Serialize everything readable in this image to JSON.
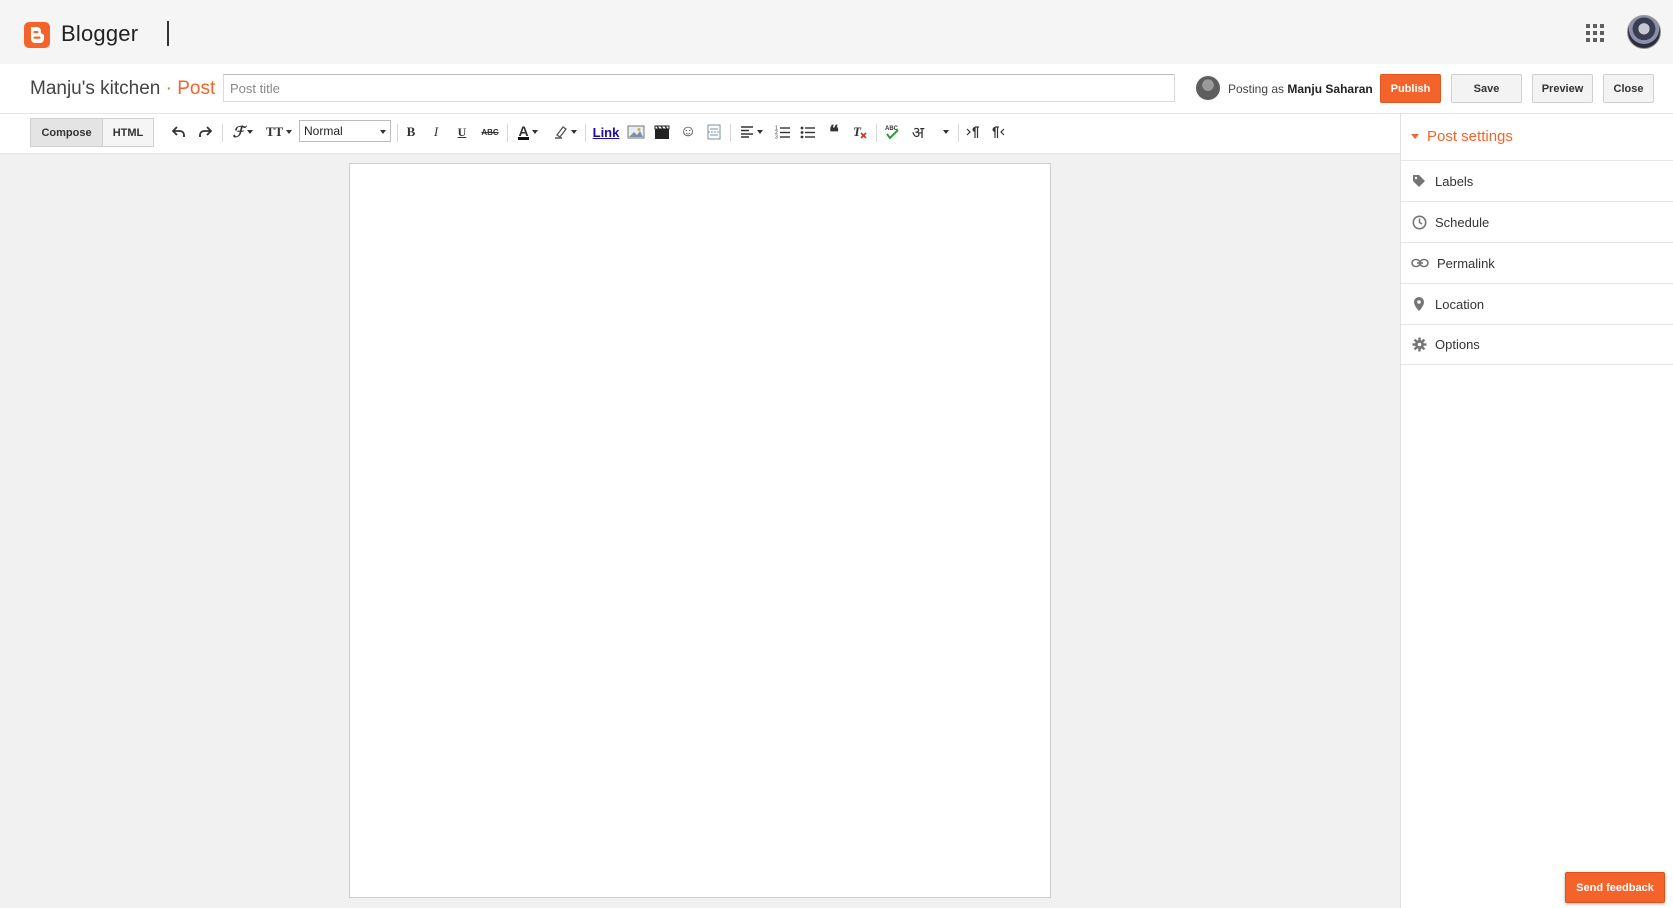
{
  "app": {
    "brand": "Blogger",
    "accent_color": "#f4642a",
    "logo_icon": "blogger-b-icon",
    "apps_icon": "apps-grid-icon"
  },
  "header": {
    "blog_name": "Manju's kitchen",
    "separator": "·",
    "kind": "Post",
    "title_placeholder": "Post title",
    "title_value": "",
    "posting_as_prefix": "Posting as",
    "posting_as_name": "Manju Saharan",
    "buttons": {
      "publish": "Publish",
      "save": "Save",
      "preview": "Preview",
      "close": "Close"
    }
  },
  "toolbar": {
    "modes": {
      "compose": "Compose",
      "html": "HTML",
      "active": "compose"
    },
    "paragraph_format": "Normal",
    "link_label": "Link",
    "icons": [
      "undo-icon",
      "redo-icon",
      "font-family-icon",
      "font-size-icon",
      "bold-icon",
      "italic-icon",
      "underline-icon",
      "strikethrough-icon",
      "text-color-icon",
      "highlight-color-icon",
      "link-icon",
      "insert-image-icon",
      "insert-video-icon",
      "emoji-icon",
      "jump-break-icon",
      "align-icon",
      "numbered-list-icon",
      "bullet-list-icon",
      "quote-icon",
      "remove-formatting-icon",
      "spellcheck-icon",
      "input-tools-icon",
      "ltr-icon",
      "rtl-icon"
    ],
    "bold_glyph": "B",
    "italic_glyph": "I",
    "underline_glyph": "U",
    "strike_glyph": "ABC",
    "text_color_glyph": "A",
    "input_tools_glyph": "अ",
    "quote_glyph": "❝",
    "emoji_glyph": "☺"
  },
  "sidebar": {
    "title": "Post settings",
    "items": [
      {
        "label": "Labels",
        "icon": "label-tag-icon"
      },
      {
        "label": "Schedule",
        "icon": "clock-icon"
      },
      {
        "label": "Permalink",
        "icon": "chain-link-icon"
      },
      {
        "label": "Location",
        "icon": "map-pin-icon"
      },
      {
        "label": "Options",
        "icon": "gear-icon"
      }
    ]
  },
  "feedback": {
    "label": "Send feedback"
  }
}
